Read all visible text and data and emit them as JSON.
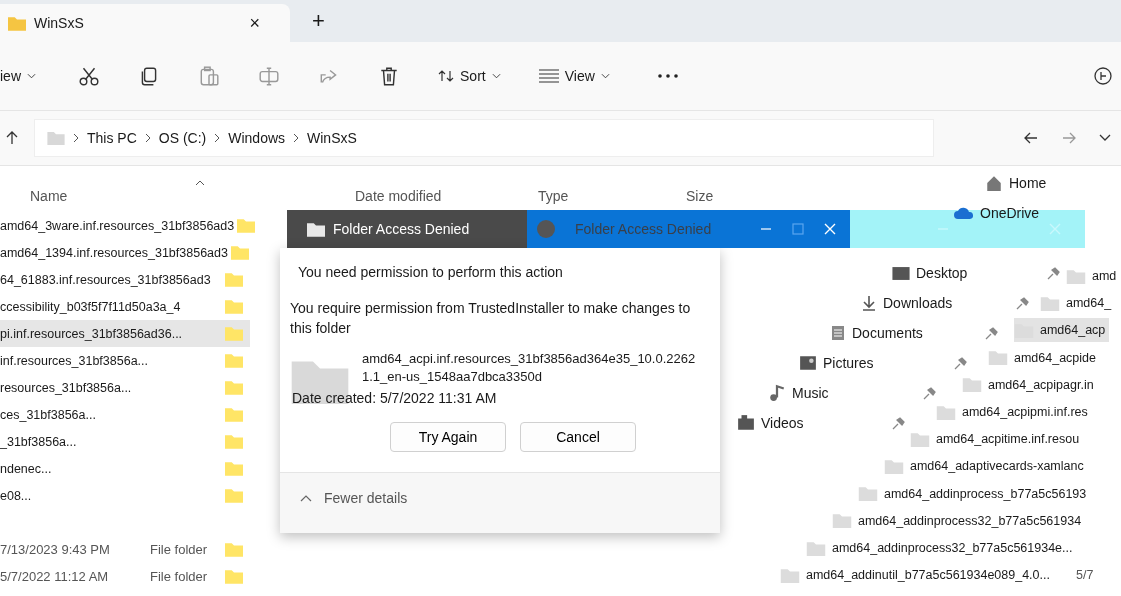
{
  "tab": {
    "title": "WinSxS",
    "close": "×",
    "new": "+"
  },
  "toolbar": {
    "new_label": "iew",
    "sort": "Sort",
    "view": "View"
  },
  "address": {
    "crumbs": [
      "This PC",
      "OS (C:)",
      "Windows",
      "WinSxS"
    ]
  },
  "columns": [
    "Name",
    "Date modified",
    "Type",
    "Size"
  ],
  "files": [
    {
      "kind": "name",
      "name": "amd64_3ware.inf.resources_31bf3856ad3",
      "selected": false
    },
    {
      "kind": "name",
      "name": "amd64_1394.inf.resources_31bf3856ad3",
      "selected": false
    },
    {
      "kind": "name",
      "name": "64_61883.inf.resources_31bf3856ad3",
      "selected": false
    },
    {
      "kind": "name",
      "name": "ccessibility_b03f5f7f11d50a3a_4",
      "selected": false
    },
    {
      "kind": "name",
      "name": "pi.inf.resources_31bf3856ad36...",
      "selected": true
    },
    {
      "kind": "name",
      "name": "inf.resources_31bf3856a...",
      "selected": false
    },
    {
      "kind": "name",
      "name": "resources_31bf3856a...",
      "selected": false
    },
    {
      "kind": "name",
      "name": "ces_31bf3856a...",
      "selected": false
    },
    {
      "kind": "name",
      "name": "_31bf3856a...",
      "selected": false
    },
    {
      "kind": "name",
      "name": "ndenec...",
      "selected": false
    },
    {
      "kind": "name",
      "name": "e08...",
      "selected": false
    },
    {
      "kind": "details",
      "date": "7/13/2023 9:43 PM",
      "type": "File folder",
      "selected": false
    },
    {
      "kind": "details",
      "date": "5/7/2022 11:12 AM",
      "type": "File folder",
      "selected": false
    }
  ],
  "dialog": {
    "title": "Folder Access Denied",
    "message": "You need permission to perform this action",
    "detail": "You require permission from TrustedInstaller to make changes to this folder",
    "item_name": "amd64_acpi.inf.resources_31bf3856ad364e35_10.0.22621.1_en-us_1548aa7dbca3350d",
    "item_date": "Date created: 5/7/2022 11:31 AM",
    "buttons": [
      "Try Again",
      "Cancel"
    ],
    "footer": "Fewer details"
  },
  "dialog2": {
    "title": "Folder Access Denied"
  },
  "nav": [
    {
      "label": "Home",
      "kind": "home",
      "pinned": false
    },
    {
      "label": "OneDrive",
      "kind": "cloud",
      "pinned": false
    },
    {
      "label": "Desktop",
      "kind": "desktop",
      "pinned": true
    },
    {
      "label": "Downloads",
      "kind": "downloads",
      "pinned": true
    },
    {
      "label": "Documents",
      "kind": "documents",
      "pinned": true
    },
    {
      "label": "Pictures",
      "kind": "pictures",
      "pinned": true
    },
    {
      "label": "Music",
      "kind": "music",
      "pinned": true
    },
    {
      "label": "Videos",
      "kind": "videos",
      "pinned": true
    }
  ],
  "right_files": [
    {
      "name": "amd",
      "selected": false
    },
    {
      "name": "amd64_",
      "selected": false
    },
    {
      "name": "amd64_acp",
      "selected": true
    },
    {
      "name": "amd64_acpide",
      "selected": false
    },
    {
      "name": "amd64_acpipagr.in",
      "selected": false
    },
    {
      "name": "amd64_acpipmi.inf.res",
      "selected": false
    },
    {
      "name": "amd64_acpitime.inf.resou",
      "selected": false
    },
    {
      "name": "amd64_adaptivecards-xamlanc",
      "selected": false
    },
    {
      "name": "amd64_addinprocess_b77a5c56193",
      "selected": false
    },
    {
      "name": "amd64_addinprocess32_b77a5c561934",
      "selected": false
    },
    {
      "name": "amd64_addinprocess32_b77a5c561934e...",
      "selected": false
    },
    {
      "name": "amd64_addinutil_b77a5c561934e089_4.0...",
      "selected": false,
      "date": "5/7"
    }
  ]
}
